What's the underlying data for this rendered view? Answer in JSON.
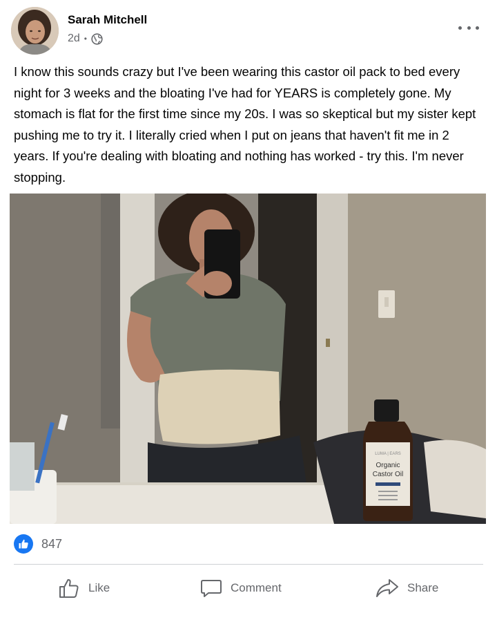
{
  "post": {
    "author": "Sarah Mitchell",
    "time": "2d",
    "separator": "•",
    "audience_icon": "globe-icon",
    "more_icon": "more-options-icon",
    "text": "I know this sounds crazy but I've been wearing this castor oil pack to bed every night for 3 weeks and the bloating I've had for YEARS is completely gone. My stomach is flat for the first time since my 20s. I was so skeptical but my sister kept pushing me to try it. I literally cried when I put on jeans that haven't fit me in 2 years. If you're dealing with bloating and nothing has worked - try this. I'm never stopping."
  },
  "photo": {
    "bottle_brand": "LUMA | EARS",
    "bottle_line1": "Organic",
    "bottle_line2": "Castor Oil"
  },
  "reactions": {
    "icon": "like-reaction-icon",
    "count": "847"
  },
  "actions": {
    "like": "Like",
    "comment": "Comment",
    "share": "Share"
  },
  "colors": {
    "accent": "#1877f2",
    "secondary_text": "#65676b",
    "divider": "#ced0d4"
  }
}
